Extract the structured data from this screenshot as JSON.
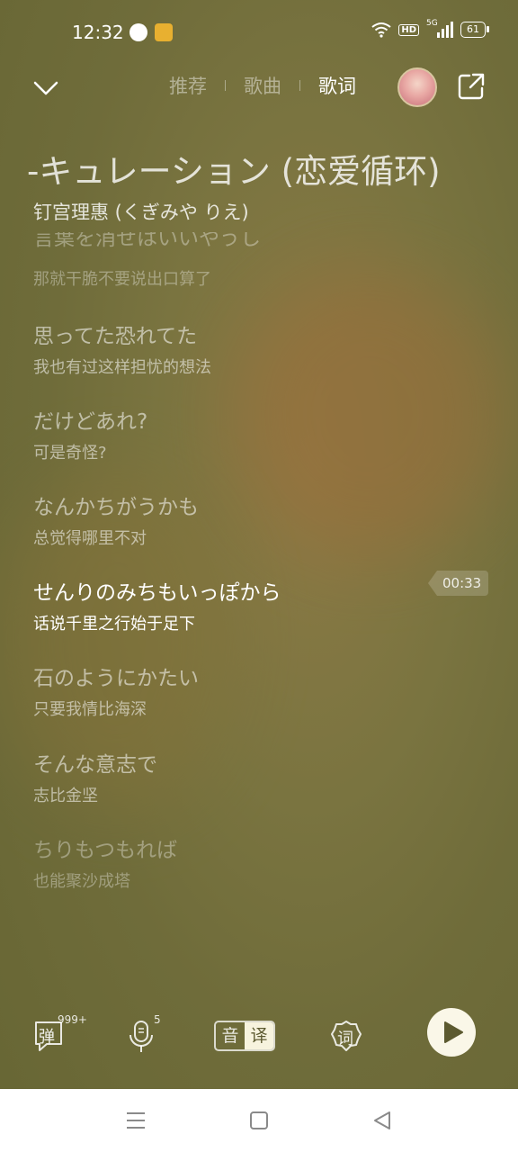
{
  "status_bar": {
    "time": "12:32",
    "network": "5G",
    "hd": "HD",
    "battery": "61"
  },
  "header": {
    "tabs": [
      {
        "label": "推荐",
        "active": false
      },
      {
        "label": "歌曲",
        "active": false
      },
      {
        "label": "歌词",
        "active": true
      }
    ]
  },
  "song": {
    "title": "-キュレーション (恋爱循环)",
    "artist": "钉宫理惠 (くぎみや りえ)"
  },
  "lyrics": [
    {
      "ja": "言葉を消せはいいやうし",
      "zh": "那就干脆不要说出口算了",
      "state": "faded"
    },
    {
      "ja": "思ってた恐れてた",
      "zh": "我也有过这样担忧的想法",
      "state": "dim"
    },
    {
      "ja": "だけどあれ?",
      "zh": "可是奇怪?",
      "state": "dim"
    },
    {
      "ja": "なんかちがうかも",
      "zh": "总觉得哪里不对",
      "state": "dim"
    },
    {
      "ja": "せんりのみちもいっぽから",
      "zh": "话说千里之行始于足下",
      "state": "current"
    },
    {
      "ja": "石のようにかたい",
      "zh": "只要我情比海深",
      "state": "dim"
    },
    {
      "ja": "そんな意志で",
      "zh": "志比金坚",
      "state": "dim"
    },
    {
      "ja": "ちりもつもれば",
      "zh": "也能聚沙成塔",
      "state": "faded"
    }
  ],
  "current_time": "00:33",
  "toolbar": {
    "danmaku_label": "弹",
    "danmaku_count": "999+",
    "sing_count": "5",
    "toggle_phonetic": "音",
    "toggle_translate": "译",
    "lyrics_label": "词"
  },
  "colors": {
    "background": "#757040",
    "accent_light": "#faf7e8"
  }
}
